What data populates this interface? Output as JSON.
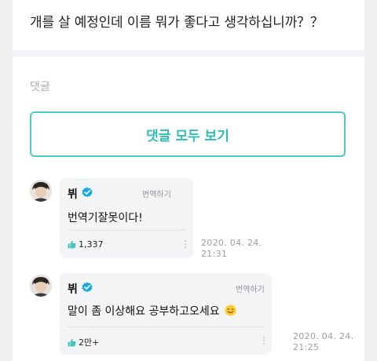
{
  "post": {
    "title": "개를 살 예정인데 이름 뭐가 좋다고 생각하십니까？？"
  },
  "comments_section": {
    "label": "댓글",
    "view_all_label": "댓글 모두 보기"
  },
  "comments": [
    {
      "author": "뷔",
      "translate_label": "번역하기",
      "text": "번역기잘못이다!",
      "like_count": "1,337",
      "date": "2020. 04. 24.",
      "time": "21:31"
    },
    {
      "author": "뷔",
      "translate_label": "번역하기",
      "text": "말이 좀 이상해요 공부하고오세요",
      "like_count": "2만+",
      "date": "2020. 04. 24.",
      "time": "21:25"
    }
  ],
  "icons": {
    "verified": "verified-badge-icon",
    "like": "thumbs-up-icon",
    "more": "more-options-icon",
    "emoji": "smiling-face-emoji"
  },
  "colors": {
    "accent": "#2fbdb6",
    "verified": "#1aa9e0",
    "like": "#4bc4bd"
  }
}
